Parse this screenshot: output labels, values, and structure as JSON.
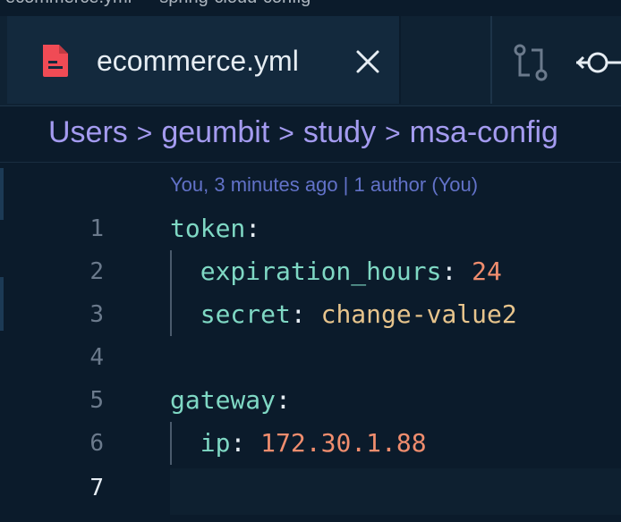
{
  "window": {
    "title_fragment": "ecommerce.yml — spring-cloud-config"
  },
  "tab": {
    "label": "ecommerce.yml",
    "icon": "yaml-file-icon",
    "color": "#f04b55"
  },
  "breadcrumb": {
    "items": [
      "Users",
      "geumbit",
      "study",
      "msa-config"
    ]
  },
  "editor": {
    "blame": "You, 3 minutes ago | 1 author (You)",
    "line_numbers": [
      "1",
      "2",
      "3",
      "4",
      "5",
      "6",
      "7"
    ],
    "lines": [
      {
        "key": "token",
        "colon": ":"
      },
      {
        "key": "expiration_hours",
        "colon": ": ",
        "value": "24"
      },
      {
        "key": "secret",
        "colon": ": ",
        "value": "change-value2"
      },
      {},
      {
        "key": "gateway",
        "colon": ":"
      },
      {
        "key": "ip",
        "colon": ": ",
        "value": "172.30.1.88"
      },
      {}
    ],
    "active_line": 7
  },
  "colors": {
    "background": "#0b1b2b",
    "key": "#7fd8c4",
    "number": "#f08d6e",
    "string": "#e7c48c",
    "breadcrumb": "#a49bf0",
    "blame": "#6272c8"
  }
}
